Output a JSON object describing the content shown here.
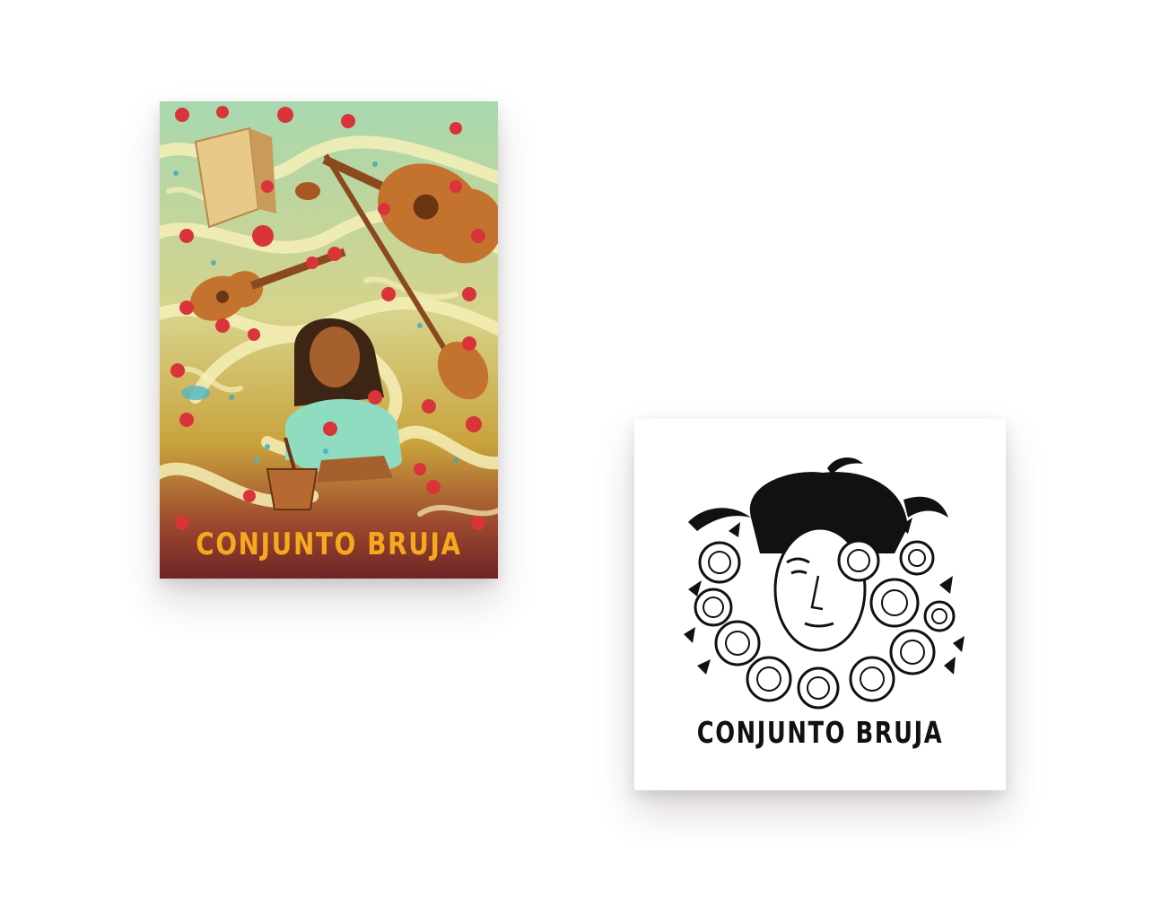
{
  "poster": {
    "title": "CONJUNTO BRUJA",
    "colors": {
      "title": "#f6a91f",
      "rose": "#d8343a",
      "swirl": "#f3eeb0",
      "mint": "#9fd3b0",
      "instrument": "#c4732e",
      "bottom": "#7a2a2a"
    }
  },
  "logo": {
    "title": "CONJUNTO BRUJA",
    "colors": {
      "ink": "#111111",
      "paper": "#ffffff"
    }
  }
}
